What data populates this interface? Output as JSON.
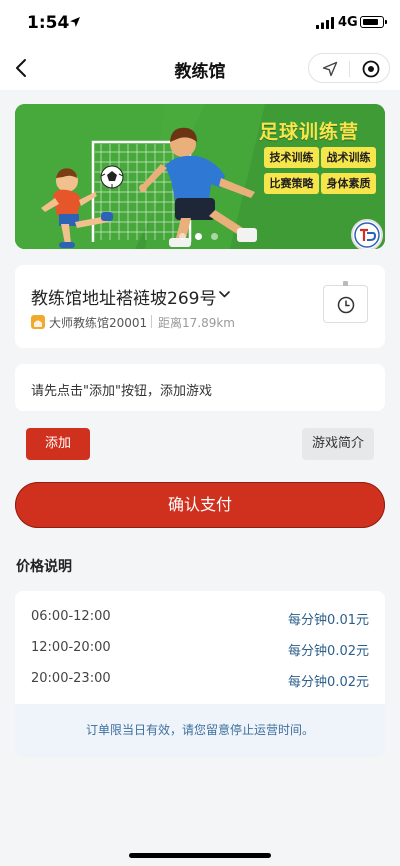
{
  "status_bar": {
    "time": "1:54",
    "network": "4G",
    "battery_level": 0.85
  },
  "nav": {
    "title": "教练馆"
  },
  "banner": {
    "title": "足球训练营",
    "tags": [
      "技术训练",
      "战术训练",
      "比赛策略",
      "身体素质"
    ],
    "slide_count": 3,
    "active_slide": 2
  },
  "venue": {
    "address": "教练馆地址褡裢坡269号",
    "name": "大师教练馆20001",
    "distance": "距离17.89km"
  },
  "hint": {
    "text": "请先点击\"添加\"按钮，添加游戏"
  },
  "buttons": {
    "add_label": "添加",
    "intro_label": "游戏简介",
    "pay_label": "确认支付"
  },
  "pricing": {
    "heading": "价格说明",
    "rows": [
      {
        "time": "06:00-12:00",
        "rate": "每分钟0.01元"
      },
      {
        "time": "12:00-20:00",
        "rate": "每分钟0.02元"
      },
      {
        "time": "20:00-23:00",
        "rate": "每分钟0.02元"
      }
    ],
    "notice": "订单限当日有效，请您留意停止运营时间。"
  },
  "colors": {
    "accent_red": "#d0311f",
    "banner_green": "#3f9b35",
    "banner_yellow": "#f7e64b",
    "rate_blue": "#2c5f8a",
    "notice_bg": "#eef4fa"
  }
}
